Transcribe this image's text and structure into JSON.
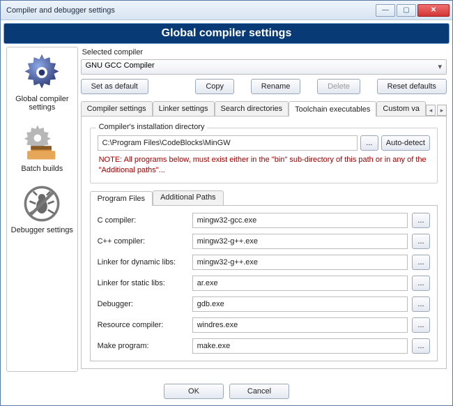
{
  "window": {
    "title": "Compiler and debugger settings"
  },
  "banner": "Global compiler settings",
  "sidebar": {
    "items": [
      {
        "label": "Global compiler settings"
      },
      {
        "label": "Batch builds"
      },
      {
        "label": "Debugger settings"
      }
    ]
  },
  "selected_compiler": {
    "label": "Selected compiler",
    "value": "GNU GCC Compiler"
  },
  "action_buttons": {
    "set_default": "Set as default",
    "copy": "Copy",
    "rename": "Rename",
    "delete": "Delete",
    "reset": "Reset defaults"
  },
  "tabs": {
    "items": [
      "Compiler settings",
      "Linker settings",
      "Search directories",
      "Toolchain executables",
      "Custom va"
    ],
    "active_index": 3
  },
  "install_dir": {
    "legend": "Compiler's installation directory",
    "path": "C:\\Program Files\\CodeBlocks\\MinGW",
    "browse": "...",
    "autodetect": "Auto-detect",
    "note": "NOTE: All programs below, must exist either in the \"bin\" sub-directory of this path or in any of the \"Additional paths\"..."
  },
  "subtabs": {
    "items": [
      "Program Files",
      "Additional Paths"
    ],
    "active_index": 0
  },
  "programs": [
    {
      "label": "C compiler:",
      "value": "mingw32-gcc.exe"
    },
    {
      "label": "C++ compiler:",
      "value": "mingw32-g++.exe"
    },
    {
      "label": "Linker for dynamic libs:",
      "value": "mingw32-g++.exe"
    },
    {
      "label": "Linker for static libs:",
      "value": "ar.exe"
    },
    {
      "label": "Debugger:",
      "value": "gdb.exe"
    },
    {
      "label": "Resource compiler:",
      "value": "windres.exe"
    },
    {
      "label": "Make program:",
      "value": "make.exe"
    }
  ],
  "browse_label": "...",
  "footer": {
    "ok": "OK",
    "cancel": "Cancel"
  }
}
